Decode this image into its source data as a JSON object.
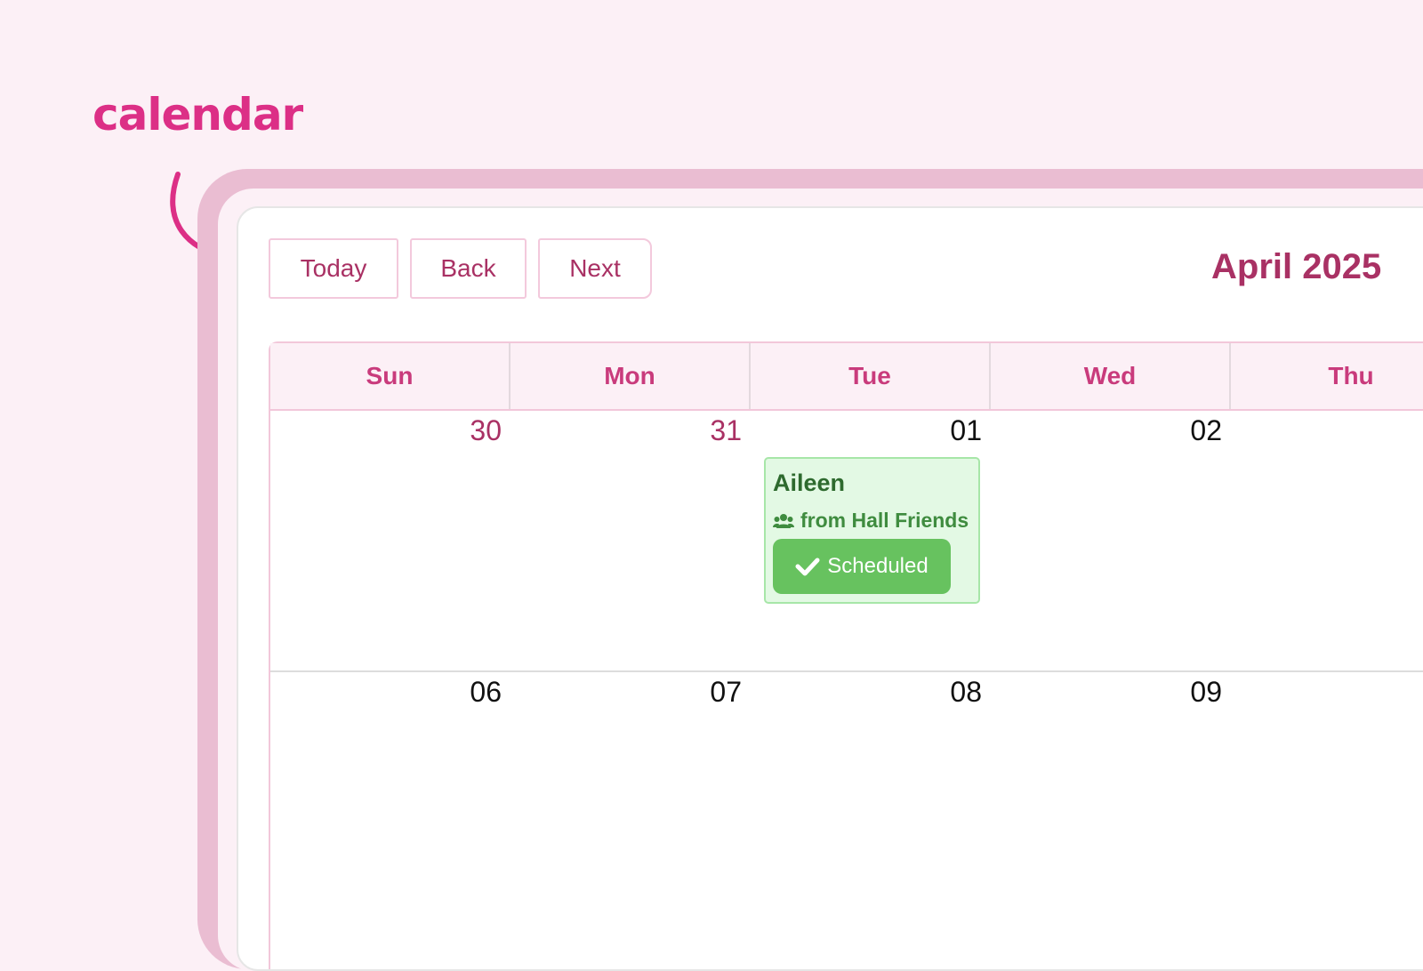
{
  "brand": {
    "title": "calendar"
  },
  "toolbar": {
    "today_label": "Today",
    "back_label": "Back",
    "next_label": "Next"
  },
  "header": {
    "month_label": "April 2025"
  },
  "weekdays": [
    "Sun",
    "Mon",
    "Tue",
    "Wed",
    "Thu"
  ],
  "weeks": [
    {
      "days": [
        "30",
        "31",
        "01",
        "02"
      ]
    },
    {
      "days": [
        "06",
        "07",
        "08",
        "09"
      ]
    }
  ],
  "event": {
    "name": "Aileen",
    "group": "from Hall Friends",
    "status": "Scheduled",
    "group_icon": "users-icon",
    "status_icon": "check-icon"
  },
  "colors": {
    "accent": "#dc2f86",
    "heading": "#a93164",
    "event_bg": "#e3f9e4",
    "status_bg": "#67c25f"
  }
}
